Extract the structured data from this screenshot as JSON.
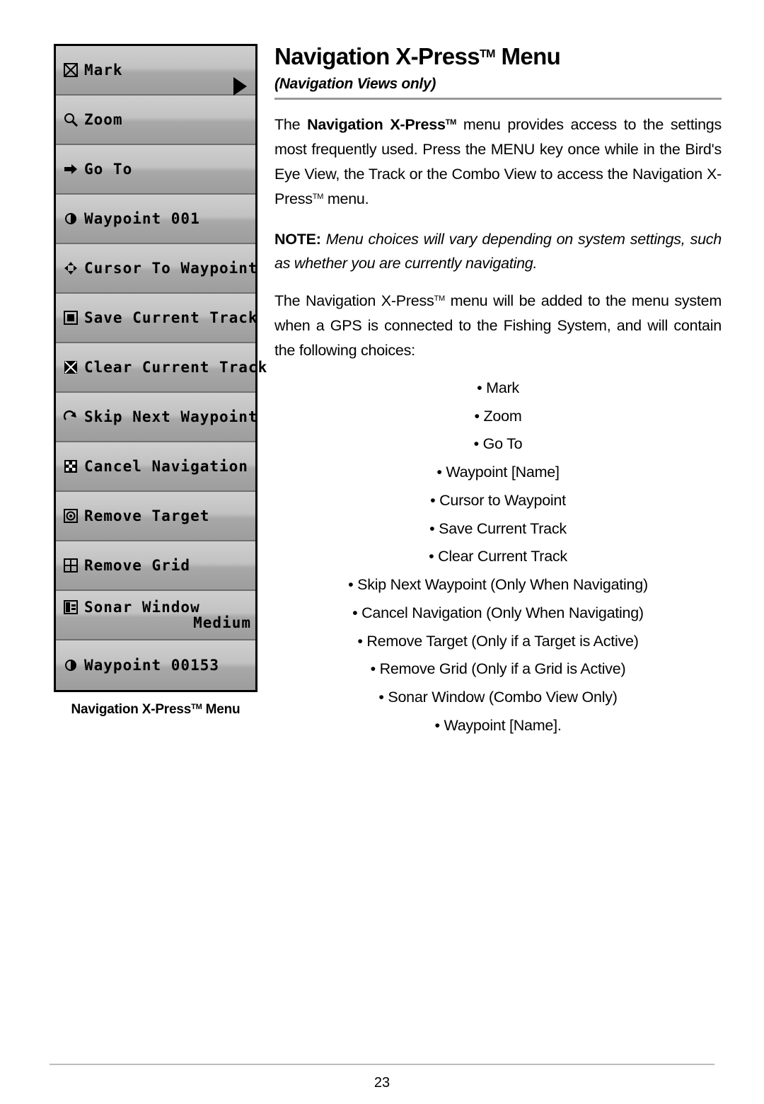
{
  "page": {
    "number": "23"
  },
  "figure": {
    "caption": "Navigation X-Press",
    "caption_sup": "TM",
    "caption_tail": " Menu",
    "menu_items": [
      {
        "label": "Mark",
        "icon": "mark-x-box-icon"
      },
      {
        "label": "Zoom",
        "icon": "magnifier-icon"
      },
      {
        "label": "Go To",
        "icon": "arrow-right-icon"
      },
      {
        "label": "Waypoint 001",
        "icon": "waypoint-circle-icon"
      },
      {
        "label": "Cursor To Waypoint",
        "icon": "crosshair-icon"
      },
      {
        "label": "Save Current Track",
        "icon": "save-disk-icon"
      },
      {
        "label": "Clear Current Track",
        "icon": "clear-x-icon"
      },
      {
        "label": "Skip Next Waypoint",
        "icon": "skip-arrow-icon"
      },
      {
        "label": "Cancel Navigation",
        "icon": "cancel-flag-icon"
      },
      {
        "label": "Remove Target",
        "icon": "target-circle-icon"
      },
      {
        "label": "Remove Grid",
        "icon": "grid-icon"
      },
      {
        "label": "Sonar Window",
        "value": "Medium",
        "icon": "sonar-window-icon"
      },
      {
        "label": "Waypoint 00153",
        "icon": "waypoint-circle-icon"
      }
    ]
  },
  "article": {
    "title": "Navigation X-Press",
    "title_sup": "TM",
    "title_tail": " Menu",
    "subtitle": "(Navigation Views only)",
    "para1_pre": "The ",
    "para1_bold": "Navigation X-Press",
    "para1_bold_sup": "TM",
    "para1_post": " menu provides access to the settings most frequently used.  Press the MENU key once while in the Bird's Eye View, the Track or the Combo View to access the Navigation X-Press",
    "para1_post_sup": "TM",
    "para1_end": " menu.",
    "note_label": "NOTE:",
    "note_text": "  Menu choices will vary depending on system settings, such as whether you are currently navigating.",
    "para2_pre": "The Navigation X-Press",
    "para2_sup": "TM",
    "para2_post": " menu will be added to the menu system when a GPS is connected to the Fishing System, and will contain the following choices:",
    "choices": [
      "Mark",
      "Zoom",
      "Go To",
      "Waypoint [Name]",
      "Cursor to Waypoint",
      "Save Current Track",
      "Clear Current Track",
      "Skip Next Waypoint (Only When Navigating)",
      "Cancel Navigation (Only When Navigating)",
      "Remove Target (Only if a Target is Active)",
      "Remove Grid (Only if a Grid is Active)",
      "Sonar Window (Combo View Only)",
      "Waypoint [Name]."
    ]
  },
  "colors": {
    "menu_bg": "#b9b9b9",
    "rule": "#9a9a9a"
  }
}
